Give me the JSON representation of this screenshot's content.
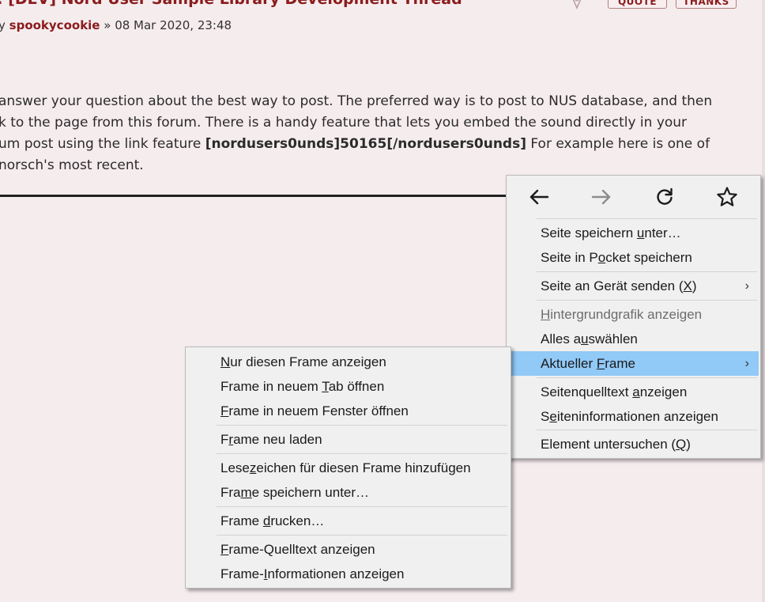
{
  "post": {
    "title": ": [DEV] Nord User Sample Library Development Thread",
    "meta_by": "y ",
    "author": "spookycookie",
    "meta_date": " » 08 Mar 2020, 23:48",
    "body": {
      "line1": "answer your question about the best way to post. The preferred way is to post to NUS database, and then",
      "line2": "k to the page from this forum. There is a handy feature that lets you embed the sound directly in your",
      "line3_start": "um post using the link feature ",
      "line3_code": "[nordusers0unds]50165[/nordusers0unds]",
      "line3_end": " For example here is one of",
      "line4": "norsch's most recent."
    },
    "buttons": {
      "quote": "QUOTE",
      "thanks": "THANKS"
    }
  },
  "main_menu": {
    "nav": [
      {
        "name": "back",
        "icon": "back-arrow-icon",
        "enabled": true
      },
      {
        "name": "forward",
        "icon": "forward-arrow-icon",
        "enabled": false
      },
      {
        "name": "reload",
        "icon": "reload-icon",
        "enabled": true
      },
      {
        "name": "bookmark",
        "icon": "star-icon",
        "enabled": true
      }
    ],
    "items": [
      {
        "pre": "Seite speichern ",
        "key": "u",
        "post": "nter…"
      },
      {
        "pre": "Seite in P",
        "key": "o",
        "post": "cket speichern"
      },
      {
        "pre": "Seite an Gerät senden (",
        "key": "X",
        "post": ")"
      },
      {
        "pre": "",
        "key": "H",
        "post": "intergrundgrafik anzeigen"
      },
      {
        "pre": "Alles a",
        "key": "u",
        "post": "swählen"
      },
      {
        "pre": "Aktueller ",
        "key": "F",
        "post": "rame"
      },
      {
        "pre": "Seitenquelltext ",
        "key": "a",
        "post": "nzeigen"
      },
      {
        "pre": "S",
        "key": "e",
        "post": "iteninformationen anzeigen"
      },
      {
        "pre": "Element untersuchen (",
        "key": "Q",
        "post": ")"
      }
    ],
    "submenu_arrow": "›"
  },
  "frame_menu": {
    "items": [
      {
        "pre": "",
        "key": "N",
        "post": "ur diesen Frame anzeigen"
      },
      {
        "pre": "Frame in neuem ",
        "key": "T",
        "post": "ab öffnen"
      },
      {
        "pre": "",
        "key": "F",
        "post": "rame in neuem Fenster öffnen"
      },
      {
        "pre": "F",
        "key": "r",
        "post": "ame neu laden"
      },
      {
        "pre": "Lese",
        "key": "z",
        "post": "eichen für diesen Frame hinzufügen"
      },
      {
        "pre": "Fra",
        "key": "m",
        "post": "e speichern unter…"
      },
      {
        "pre": "Frame ",
        "key": "d",
        "post": "rucken…"
      },
      {
        "pre": "",
        "key": "F",
        "post": "rame-Quelltext anzeigen"
      },
      {
        "pre": "Frame-",
        "key": "I",
        "post": "nformationen anzeigen"
      }
    ]
  },
  "colors": {
    "page_bg": "#f5ecee",
    "title_red": "#8b1c1c",
    "menu_bg": "#f0f0f0",
    "menu_highlight": "#91c9f7"
  }
}
